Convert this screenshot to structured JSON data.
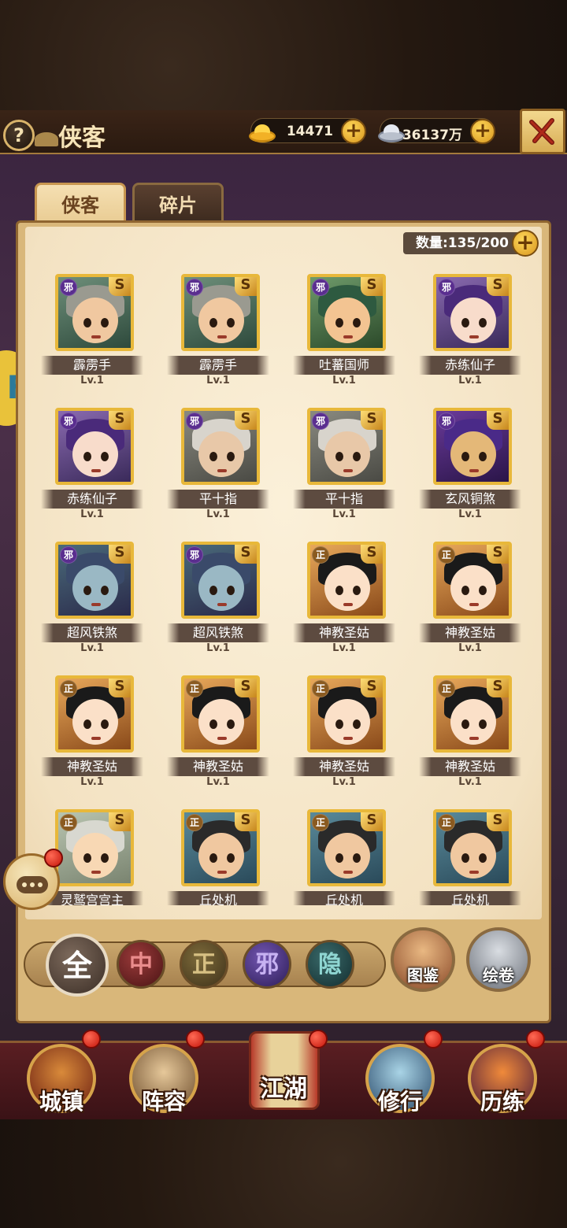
{
  "header": {
    "help_label": "?",
    "title": "侠客",
    "gold": "14471",
    "silver": "36137万",
    "plus": "+"
  },
  "tabs": [
    {
      "label": "侠客",
      "active": true
    },
    {
      "label": "碎片",
      "active": false
    }
  ],
  "roster": {
    "count_label": "数量:135/200",
    "plus": "+"
  },
  "heroes": [
    {
      "name": "霹雳手",
      "level": "Lv.1",
      "alignment": "邪",
      "grade": "S",
      "theme": "monk"
    },
    {
      "name": "霹雳手",
      "level": "Lv.1",
      "alignment": "邪",
      "grade": "S",
      "theme": "monk"
    },
    {
      "name": "吐蕃国师",
      "level": "Lv.1",
      "alignment": "邪",
      "grade": "S",
      "theme": "green"
    },
    {
      "name": "赤练仙子",
      "level": "Lv.1",
      "alignment": "邪",
      "grade": "S",
      "theme": "purple"
    },
    {
      "name": "赤练仙子",
      "level": "Lv.1",
      "alignment": "邪",
      "grade": "S",
      "theme": "purple"
    },
    {
      "name": "平十指",
      "level": "Lv.1",
      "alignment": "邪",
      "grade": "S",
      "theme": "elder"
    },
    {
      "name": "平十指",
      "level": "Lv.1",
      "alignment": "邪",
      "grade": "S",
      "theme": "elder"
    },
    {
      "name": "玄风铜煞",
      "level": "Lv.1",
      "alignment": "邪",
      "grade": "S",
      "theme": "violet"
    },
    {
      "name": "超风铁煞",
      "level": "Lv.1",
      "alignment": "邪",
      "grade": "S",
      "theme": "ghost"
    },
    {
      "name": "超风铁煞",
      "level": "Lv.1",
      "alignment": "邪",
      "grade": "S",
      "theme": "ghost"
    },
    {
      "name": "神教圣姑",
      "level": "Lv.1",
      "alignment": "正",
      "grade": "S",
      "theme": "saint"
    },
    {
      "name": "神教圣姑",
      "level": "Lv.1",
      "alignment": "正",
      "grade": "S",
      "theme": "saint"
    },
    {
      "name": "神教圣姑",
      "level": "Lv.1",
      "alignment": "正",
      "grade": "S",
      "theme": "saint"
    },
    {
      "name": "神教圣姑",
      "level": "Lv.1",
      "alignment": "正",
      "grade": "S",
      "theme": "saint"
    },
    {
      "name": "神教圣姑",
      "level": "Lv.1",
      "alignment": "正",
      "grade": "S",
      "theme": "saint"
    },
    {
      "name": "神教圣姑",
      "level": "Lv.1",
      "alignment": "正",
      "grade": "S",
      "theme": "saint"
    },
    {
      "name": "灵鹫宫宫主",
      "level": "",
      "alignment": "正",
      "grade": "S",
      "theme": "child"
    },
    {
      "name": "丘处机",
      "level": "",
      "alignment": "正",
      "grade": "S",
      "theme": "taoist"
    },
    {
      "name": "丘处机",
      "level": "",
      "alignment": "正",
      "grade": "S",
      "theme": "taoist"
    },
    {
      "name": "丘处机",
      "level": "",
      "alignment": "正",
      "grade": "S",
      "theme": "taoist"
    }
  ],
  "filters": {
    "all": "全",
    "zhong": "中",
    "zheng": "正",
    "xie": "邪",
    "yin": "隐"
  },
  "side_buttons": {
    "tujian": "图鉴",
    "huijuan": "绘卷"
  },
  "nav": {
    "town": "城镇",
    "lineup": "阵容",
    "jianghu": "江湖",
    "cultivate": "修行",
    "training": "历练"
  },
  "colors": {
    "gold_accent": "#e8b83a",
    "panel_bg": "#f3e2c2",
    "nav_bg": "#5a1e22",
    "xie_badge": "#5a2e8f",
    "zheng_badge": "#8a5a20"
  }
}
